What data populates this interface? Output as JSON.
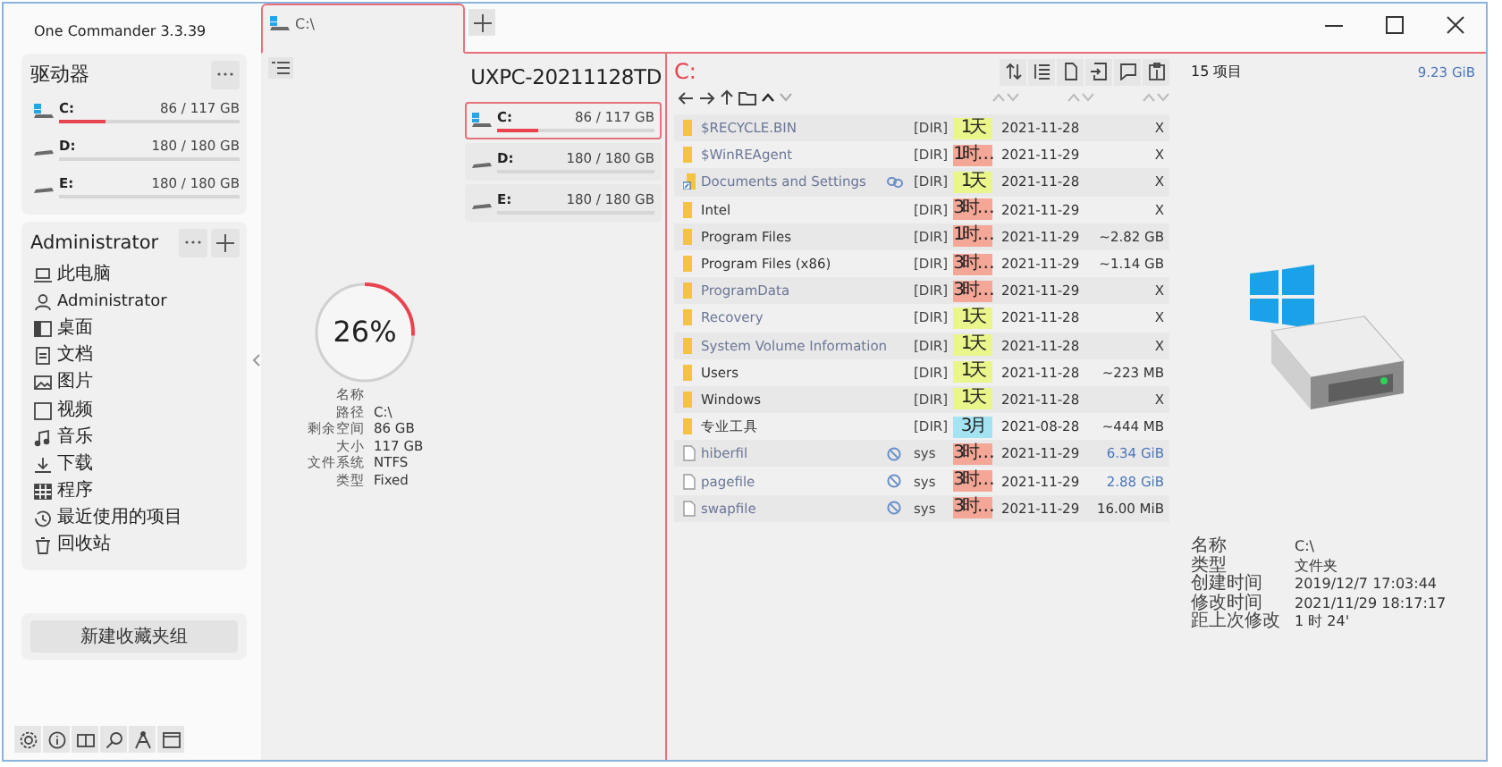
{
  "app_title": "One Commander 3.3.39",
  "tabs": [
    {
      "label": "C:\\",
      "selected": true
    }
  ],
  "drives_panel": {
    "title": "驱动器",
    "drives": [
      {
        "label": "C:",
        "usage": "86 / 117 GB",
        "level": 0.26,
        "kind": "system"
      },
      {
        "label": "D:",
        "usage": "180 / 180 GB",
        "kind": "data"
      },
      {
        "label": "E:",
        "usage": "180 / 180 GB",
        "kind": "data"
      }
    ]
  },
  "favorites": {
    "title": "Administrator",
    "items": [
      {
        "label": "此电脑",
        "kind": "computer"
      },
      {
        "label": "Administrator",
        "kind": "user"
      },
      {
        "label": "桌面",
        "kind": "desktop"
      },
      {
        "label": "文档",
        "kind": "document"
      },
      {
        "label": "图片",
        "kind": "image"
      },
      {
        "label": "视频",
        "kind": "video"
      },
      {
        "label": "音乐",
        "kind": "music"
      },
      {
        "label": "下载",
        "kind": "download"
      },
      {
        "label": "程序",
        "kind": "apps"
      },
      {
        "label": "最近使用的项目",
        "kind": "recent"
      },
      {
        "label": "回收站",
        "kind": "trash"
      }
    ]
  },
  "new_group_button": "新建收藏夹组",
  "pane": {
    "computer_name": "UXPC-20211128TD",
    "drives": [
      {
        "label": "C:",
        "usage": "86 / 117 GB",
        "level": 0.26,
        "kind": "system",
        "selected": true
      },
      {
        "label": "D:",
        "usage": "180 / 180 GB",
        "kind": "data",
        "selected": false
      },
      {
        "label": "E:",
        "usage": "180 / 180 GB",
        "kind": "data",
        "selected": false
      }
    ],
    "usage": {
      "percent": "26%",
      "level": 0.26
    },
    "info": [
      {
        "label": "名称"
      },
      {
        "label": "路径",
        "value": "C:\\"
      },
      {
        "label": "剩余空间",
        "value": "86 GB"
      },
      {
        "label": "大小",
        "value": "117 GB"
      },
      {
        "label": "文件系统",
        "value": "NTFS"
      },
      {
        "label": "类型",
        "value": "Fixed"
      }
    ]
  },
  "files": {
    "path": "C:",
    "rows": [
      {
        "name": "$RECYCLE.BIN",
        "kind": "folder",
        "hidden": true,
        "type": "[DIR]",
        "age": "1天",
        "color": "#eaf58c",
        "date": "2021-11-28",
        "size": "X",
        "size_highlight": false
      },
      {
        "name": "$WinREAgent",
        "kind": "folder",
        "hidden": true,
        "type": "[DIR]",
        "age": "1时…",
        "color": "#f4a797",
        "date": "2021-11-29",
        "size": "X",
        "size_highlight": false
      },
      {
        "name": "Documents and Settings",
        "kind": "junction",
        "hidden": true,
        "type": "[DIR]",
        "age": "1天",
        "color": "#eaf58c",
        "date": "2021-11-28",
        "size": "X",
        "size_highlight": false
      },
      {
        "name": "Intel",
        "kind": "folder",
        "hidden": false,
        "type": "[DIR]",
        "age": "3时…",
        "color": "#f4a797",
        "date": "2021-11-29",
        "size": "X",
        "size_highlight": false
      },
      {
        "name": "Program Files",
        "kind": "folder",
        "hidden": false,
        "type": "[DIR]",
        "age": "1时…",
        "color": "#f4a797",
        "date": "2021-11-29",
        "size": "~2.82 GB",
        "size_highlight": false
      },
      {
        "name": "Program Files (x86)",
        "kind": "folder",
        "hidden": false,
        "type": "[DIR]",
        "age": "3时…",
        "color": "#f4a797",
        "date": "2021-11-29",
        "size": "~1.14 GB",
        "size_highlight": false
      },
      {
        "name": "ProgramData",
        "kind": "folder",
        "hidden": true,
        "type": "[DIR]",
        "age": "3时…",
        "color": "#f4a797",
        "date": "2021-11-29",
        "size": "X",
        "size_highlight": false
      },
      {
        "name": "Recovery",
        "kind": "folder",
        "hidden": true,
        "type": "[DIR]",
        "age": "1天",
        "color": "#eaf58c",
        "date": "2021-11-28",
        "size": "X",
        "size_highlight": false
      },
      {
        "name": "System Volume Information",
        "kind": "folder",
        "hidden": true,
        "type": "[DIR]",
        "age": "1天",
        "color": "#eaf58c",
        "date": "2021-11-28",
        "size": "X",
        "size_highlight": false
      },
      {
        "name": "Users",
        "kind": "folder",
        "hidden": false,
        "type": "[DIR]",
        "age": "1天",
        "color": "#eaf58c",
        "date": "2021-11-28",
        "size": "~223 MB",
        "size_highlight": false
      },
      {
        "name": "Windows",
        "kind": "folder",
        "hidden": false,
        "type": "[DIR]",
        "age": "1天",
        "color": "#eaf58c",
        "date": "2021-11-28",
        "size": "X",
        "size_highlight": false
      },
      {
        "name": "专业工具",
        "kind": "folder",
        "hidden": false,
        "type": "[DIR]",
        "age": "3月",
        "color": "#a4e4f2",
        "date": "2021-08-28",
        "size": "~444 MB",
        "size_highlight": false
      },
      {
        "name": "hiberfil",
        "kind": "file",
        "hidden": true,
        "type": "sys",
        "age": "3时…",
        "color": "#f4a797",
        "date": "2021-11-29",
        "size": "6.34 GiB",
        "size_highlight": true
      },
      {
        "name": "pagefile",
        "kind": "file",
        "hidden": true,
        "type": "sys",
        "age": "3时…",
        "color": "#f4a797",
        "date": "2021-11-29",
        "size": "2.88 GiB",
        "size_highlight": true
      },
      {
        "name": "swapfile",
        "kind": "file",
        "hidden": true,
        "type": "sys",
        "age": "3时…",
        "color": "#f4a797",
        "date": "2021-11-29",
        "size": "16.00 MiB",
        "size_highlight": false
      }
    ]
  },
  "preview": {
    "count": "15 项目",
    "total": "9.23 GiB",
    "info": [
      {
        "label": "名称",
        "value": "C:\\"
      },
      {
        "label": "类型",
        "value": "文件夹"
      },
      {
        "label": "创建时间",
        "value": "2019/12/7 17:03:44"
      },
      {
        "label": "修改时间",
        "value": "2021/11/29 18:17:17"
      },
      {
        "label": "距上次修改",
        "value": "1 时 24'"
      }
    ]
  }
}
